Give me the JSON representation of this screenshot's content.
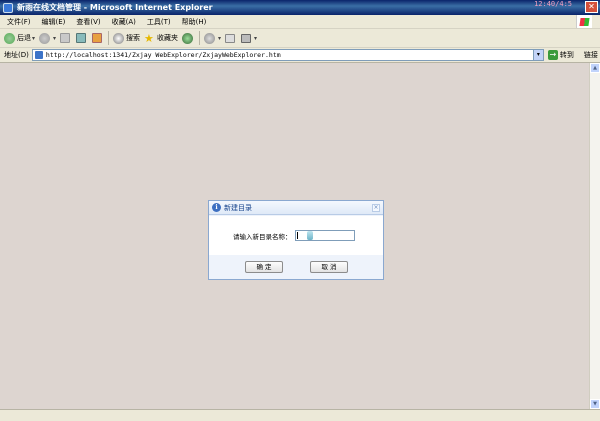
{
  "window": {
    "title": "新雨在线文档管理 - Microsoft Internet Explorer",
    "clock": "12:40/4:5"
  },
  "menu": [
    "文件(F)",
    "编辑(E)",
    "查看(V)",
    "收藏(A)",
    "工具(T)",
    "帮助(H)"
  ],
  "toolbar": {
    "back": "后退",
    "search": "搜索",
    "favorites": "收藏夹"
  },
  "address": {
    "label": "地址(D)",
    "url": "http://localhost:1341/Zxjay WebExplorer/ZxjayWebExplorer.htm",
    "go": "转到",
    "links": "链接"
  },
  "dialog": {
    "title": "新建目录",
    "prompt": "请输入新目录名称：",
    "input_value": "",
    "ok_label": "确 定",
    "cancel_label": "取 消"
  }
}
